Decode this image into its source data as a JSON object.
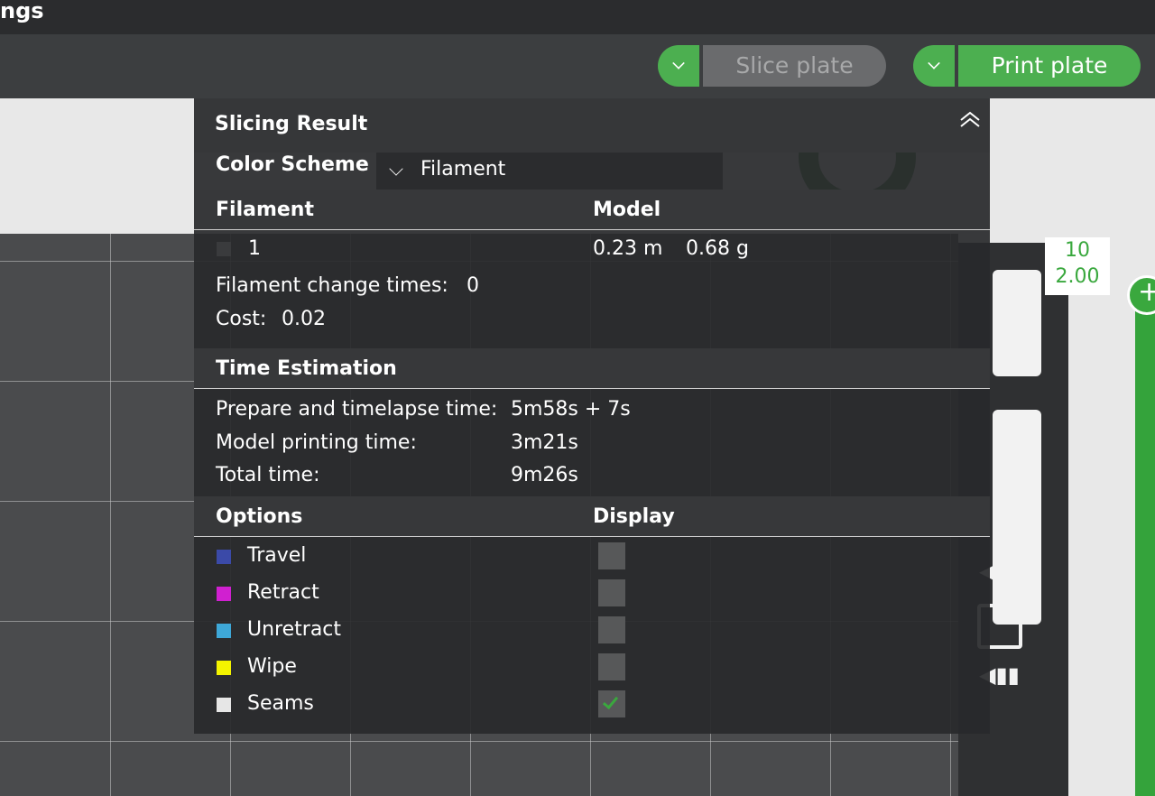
{
  "window": {
    "title_fragment": "ngs"
  },
  "toolbar": {
    "slice_label": "Slice plate",
    "print_label": "Print plate"
  },
  "layer_slider": {
    "layer": "10",
    "height": "2.00"
  },
  "panel": {
    "title": "Slicing Result",
    "color_scheme_label": "Color Scheme",
    "color_scheme_value": "Filament",
    "filament_header": "Filament",
    "model_header": "Model",
    "filament_row": {
      "id": "1",
      "length": "0.23 m",
      "weight": "0.68 g"
    },
    "change_times_label": "Filament change times:",
    "change_times_value": "0",
    "cost_label": "Cost:",
    "cost_value": "0.02",
    "time_header": "Time Estimation",
    "times": [
      {
        "label": "Prepare and timelapse time:",
        "value": "5m58s + 7s"
      },
      {
        "label": "Model printing time:",
        "value": "3m21s"
      },
      {
        "label": "Total time:",
        "value": "9m26s"
      }
    ],
    "options_header": "Options",
    "display_header": "Display",
    "options": [
      {
        "label": "Travel",
        "color": "#3b4aa8",
        "checked": false
      },
      {
        "label": "Retract",
        "color": "#d020d0",
        "checked": false
      },
      {
        "label": "Unretract",
        "color": "#3ea8d8",
        "checked": false
      },
      {
        "label": "Wipe",
        "color": "#f4f400",
        "checked": false
      },
      {
        "label": "Seams",
        "color": "#e6e6e6",
        "checked": true
      }
    ]
  },
  "colors": {
    "accent": "#4caf50",
    "panel_bg": "#28292b"
  }
}
